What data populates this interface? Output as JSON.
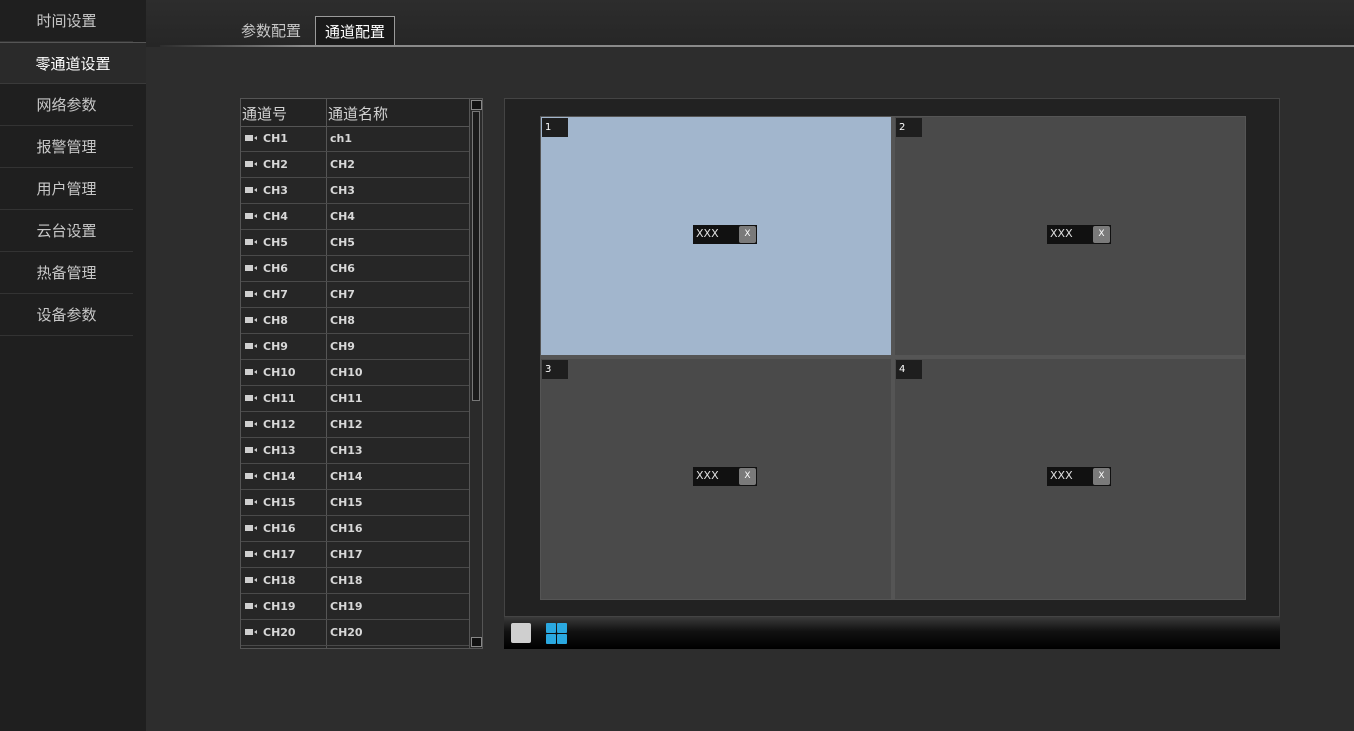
{
  "sidebar": {
    "items": [
      {
        "label": "时间设置"
      },
      {
        "label": "零通道设置"
      },
      {
        "label": "网络参数"
      },
      {
        "label": "报警管理"
      },
      {
        "label": "用户管理"
      },
      {
        "label": "云台设置"
      },
      {
        "label": "热备管理"
      },
      {
        "label": "设备参数"
      }
    ],
    "active": "零通道设置"
  },
  "tabs": [
    {
      "label": "参数配置"
    },
    {
      "label": "通道配置"
    }
  ],
  "active_tab": "通道配置",
  "channel_table": {
    "headers": [
      "通道号",
      "通道名称"
    ],
    "rows": [
      {
        "num": "CH1",
        "name": "ch1"
      },
      {
        "num": "CH2",
        "name": "CH2"
      },
      {
        "num": "CH3",
        "name": "CH3"
      },
      {
        "num": "CH4",
        "name": "CH4"
      },
      {
        "num": "CH5",
        "name": "CH5"
      },
      {
        "num": "CH6",
        "name": "CH6"
      },
      {
        "num": "CH7",
        "name": "CH7"
      },
      {
        "num": "CH8",
        "name": "CH8"
      },
      {
        "num": "CH9",
        "name": "CH9"
      },
      {
        "num": "CH10",
        "name": "CH10"
      },
      {
        "num": "CH11",
        "name": "CH11"
      },
      {
        "num": "CH12",
        "name": "CH12"
      },
      {
        "num": "CH13",
        "name": "CH13"
      },
      {
        "num": "CH14",
        "name": "CH14"
      },
      {
        "num": "CH15",
        "name": "CH15"
      },
      {
        "num": "CH16",
        "name": "CH16"
      },
      {
        "num": "CH17",
        "name": "CH17"
      },
      {
        "num": "CH18",
        "name": "CH18"
      },
      {
        "num": "CH19",
        "name": "CH19"
      },
      {
        "num": "CH20",
        "name": "CH20"
      }
    ]
  },
  "preview": {
    "cells": [
      {
        "index": "1",
        "tag": "XXX",
        "remove": "X",
        "selected": true
      },
      {
        "index": "2",
        "tag": "XXX",
        "remove": "X",
        "selected": false
      },
      {
        "index": "3",
        "tag": "XXX",
        "remove": "X",
        "selected": false
      },
      {
        "index": "4",
        "tag": "XXX",
        "remove": "X",
        "selected": false
      }
    ]
  },
  "toolbar": {
    "layouts": [
      "single-view-icon",
      "quad-view-icon"
    ]
  },
  "colors": {
    "selected_cell": "#a2b6cd",
    "accent": "#2aa8e0"
  }
}
